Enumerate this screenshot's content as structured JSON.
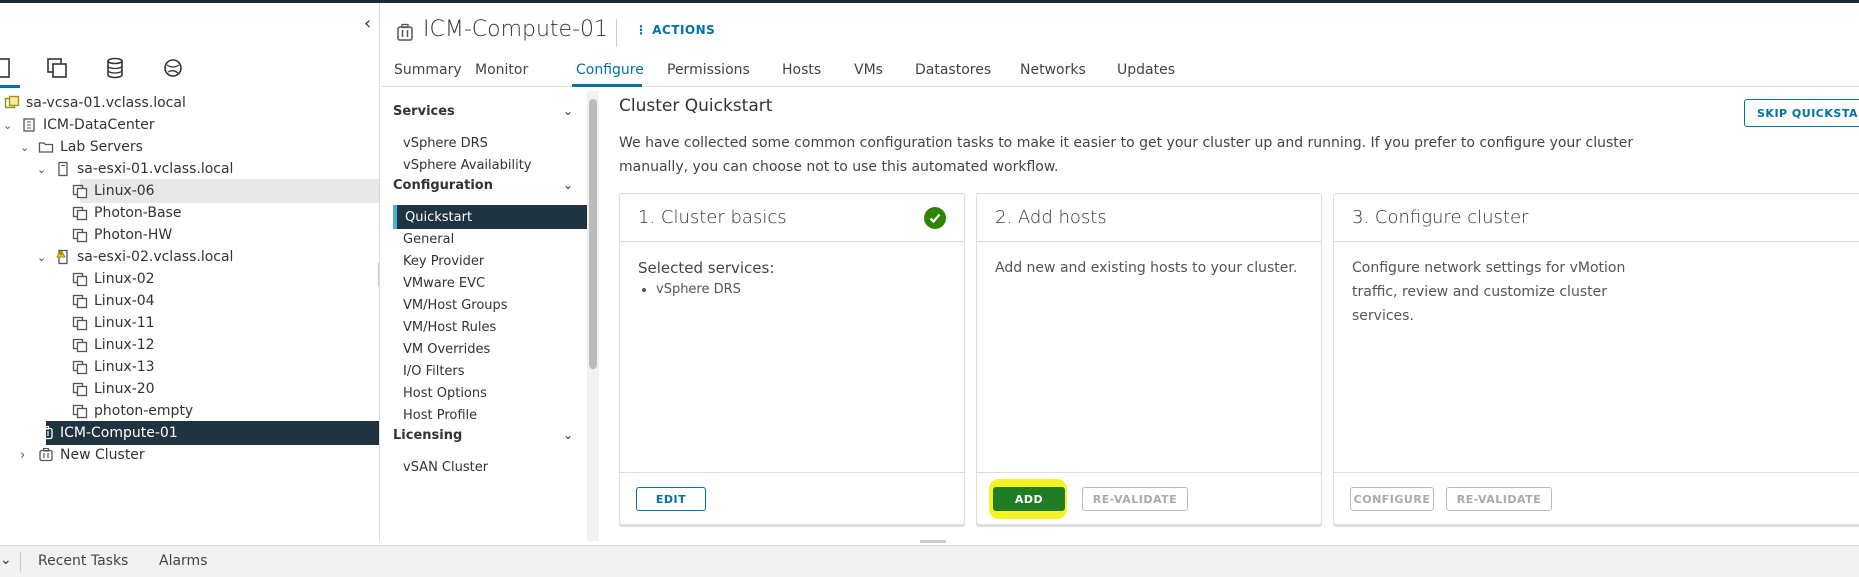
{
  "nav": {
    "items": [
      {
        "label": "sa-vcsa-01.vclass.local",
        "type": "vcenter",
        "expanded": true
      },
      {
        "label": "ICM-DataCenter",
        "type": "datacenter",
        "expanded": true
      },
      {
        "label": "Lab Servers",
        "type": "folder",
        "expanded": true
      },
      {
        "label": "sa-esxi-01.vclass.local",
        "type": "host",
        "expanded": true
      },
      {
        "label": "Linux-06",
        "type": "vm"
      },
      {
        "label": "Photon-Base",
        "type": "vm"
      },
      {
        "label": "Photon-HW",
        "type": "vm"
      },
      {
        "label": "sa-esxi-02.vclass.local",
        "type": "host-warning",
        "expanded": true
      },
      {
        "label": "Linux-02",
        "type": "vm"
      },
      {
        "label": "Linux-04",
        "type": "vm"
      },
      {
        "label": "Linux-11",
        "type": "vm"
      },
      {
        "label": "Linux-12",
        "type": "vm"
      },
      {
        "label": "Linux-13",
        "type": "vm"
      },
      {
        "label": "Linux-20",
        "type": "vm"
      },
      {
        "label": "photon-empty",
        "type": "vm"
      },
      {
        "label": "ICM-Compute-01",
        "type": "cluster"
      },
      {
        "label": "New Cluster",
        "type": "cluster",
        "expanded": false
      }
    ]
  },
  "header": {
    "title": "ICM-Compute-01",
    "actions_label": "ACTIONS"
  },
  "tabs": [
    "Summary",
    "Monitor",
    "Configure",
    "Permissions",
    "Hosts",
    "VMs",
    "Datastores",
    "Networks",
    "Updates"
  ],
  "active_tab": "Configure",
  "subnav": {
    "services_header": "Services",
    "services": [
      "vSphere DRS",
      "vSphere Availability"
    ],
    "configuration_header": "Configuration",
    "configuration": [
      "Quickstart",
      "General",
      "Key Provider",
      "VMware EVC",
      "VM/Host Groups",
      "VM/Host Rules",
      "VM Overrides",
      "I/O Filters",
      "Host Options",
      "Host Profile"
    ],
    "licensing_header": "Licensing",
    "licensing": [
      "vSAN Cluster"
    ],
    "active_item": "Quickstart"
  },
  "quickstart": {
    "title": "Cluster Quickstart",
    "skip_label": "SKIP QUICKSTART",
    "description": "We have collected some common configuration tasks to make it easier to get your cluster up and running. If you prefer to configure your cluster manually, you can choose not to use this automated workflow.",
    "cards": [
      {
        "title": "1. Cluster basics",
        "selected_services_label": "Selected services:",
        "services": [
          "vSphere DRS"
        ],
        "edit_label": "EDIT"
      },
      {
        "title": "2. Add hosts",
        "body": "Add new and existing hosts to your cluster.",
        "add_label": "ADD",
        "revalidate_label": "RE-VALIDATE"
      },
      {
        "title": "3. Configure cluster",
        "body": "Configure network settings for vMotion traffic, review and customize cluster services.",
        "configure_label": "CONFIGURE",
        "revalidate_label": "RE-VALIDATE"
      }
    ]
  },
  "bottom": {
    "recent_tasks": "Recent Tasks",
    "alarms": "Alarms"
  },
  "colors": {
    "accent": "#0072a3",
    "selected_bg": "#1f3341",
    "success": "#2f8400",
    "highlight": "#f4f000"
  }
}
